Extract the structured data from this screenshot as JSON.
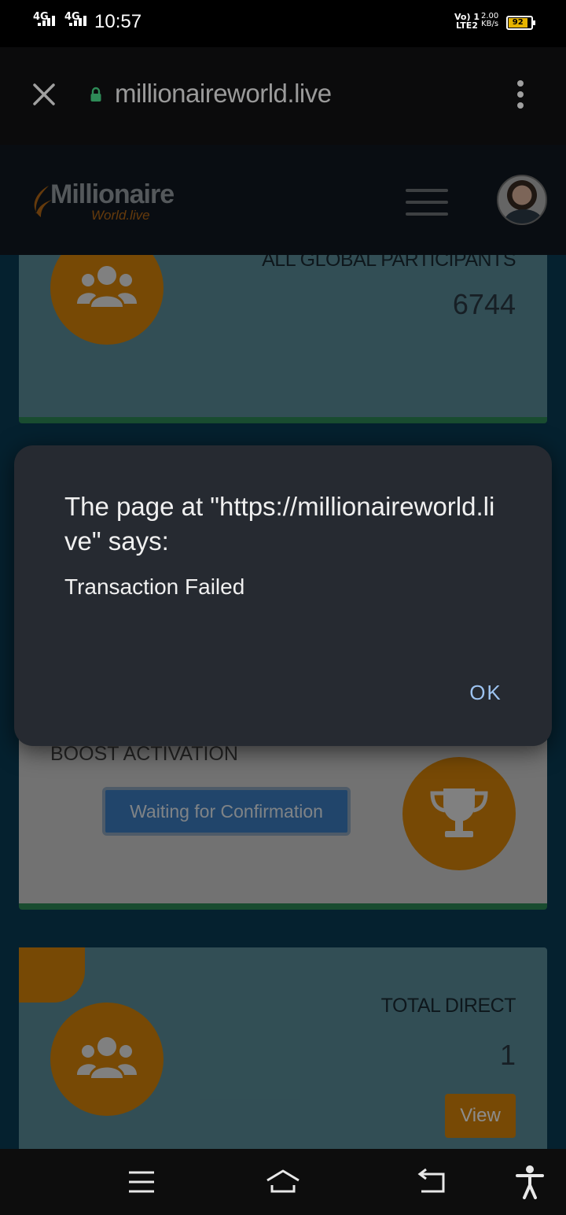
{
  "status_bar": {
    "network1": "4G",
    "network2": "4G",
    "time": "10:57",
    "volte_line1": "Vo) 1",
    "volte_line2": "LTE2",
    "speed_value": "2.00",
    "speed_unit": "KB/s",
    "battery": "92"
  },
  "browser": {
    "url": "millionaireworld.live"
  },
  "site": {
    "logo_line1": "Millionaire",
    "logo_line2": "World.live"
  },
  "cards": {
    "global_label": "ALL GLOBAL PARTICIPANTS",
    "global_value": "6744",
    "boost_label": "BOOST ACTIVATION",
    "boost_button": "Waiting for Confirmation",
    "direct_label": "TOTAL DIRECT",
    "direct_value": "1",
    "view_button": "View"
  },
  "dialog": {
    "title": "The page at \"https://millionaireworld.live\" says:",
    "message": "Transaction Failed",
    "ok_label": "OK"
  },
  "colors": {
    "accent_orange": "#d9860a",
    "card_teal": "#5b8f9b",
    "dialog_bg": "#262a31",
    "ok_text": "#9dc3f0"
  }
}
